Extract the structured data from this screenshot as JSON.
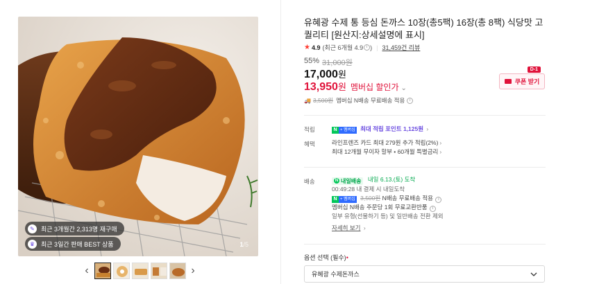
{
  "gallery": {
    "badges": [
      {
        "icon": "review-icon",
        "icon_glyph": "✎",
        "text": "최근 3개월간 2,313명 재구매"
      },
      {
        "icon": "best-icon",
        "icon_glyph": "♛",
        "text": "최근 3일간 판매 BEST 상품"
      }
    ],
    "counter": {
      "current": "1",
      "total": "/5"
    },
    "prev_arrow": "‹",
    "next_arrow": "›",
    "thumb_count": 5,
    "active_thumb": 1
  },
  "product": {
    "title": "유혜광 수제 통 등심 돈까스 10장(총5팩) 16장(총 8팩) 식당맛 고퀄리티 [원산지:상세설명에 표시]",
    "rating": {
      "star": "★",
      "score": "4.9",
      "recent": "(최근 6개월 4.9",
      "info_glyph": "i",
      "recent_close": ")",
      "reviews": "31,459건 리뷰"
    },
    "discount_rate": "55%",
    "original_price": "31,000원",
    "price": "17,000",
    "price_unit": "원",
    "member_price": "13,950",
    "member_unit": "원",
    "member_label": "멤버십 할인가",
    "member_chevron": "⌄",
    "coupon": {
      "badge": "D-1",
      "label": "쿠폰 받기"
    },
    "shipping_line": {
      "prefix": "🚚",
      "original": "3,500원",
      "text": "멤버십 N배송 무료배송 적용",
      "info_glyph": "i"
    }
  },
  "benefits": {
    "points_label": "적립",
    "npay_n": "N",
    "npay_text": "+ 멤버십",
    "points_text": "최대 적립 포인트",
    "points_value": "1,125원",
    "perks_label": "혜택",
    "perks_lines": [
      "라인프렌즈 카드 최대 279원 추가 적립(2%)",
      "최대 12개월 무이자 할부 • 60개월 특별금리"
    ],
    "chevron": "›"
  },
  "delivery": {
    "label": "배송",
    "fast_tag": "내일배송",
    "fast_dot": "N",
    "arrival": "내일 6.13.(토) 도착",
    "cutoff": "00:49:28  내 결제 시 내일도착",
    "free_ship_original": "3,500원",
    "free_ship_text": "N배송 무료배송 적용",
    "exchange_text": "멤버십 N배송 주문당 1회 무료교환반품",
    "exclude_text": "일부 유형(선물하기 등) 및 일반배송 전환 제외",
    "detail_link": "자세히 보기",
    "info_glyph": "i"
  },
  "option": {
    "label": "옵션 선택 (필수)",
    "required_mark": "•",
    "selected": "유혜광 수제돈까스"
  },
  "colors": {
    "accent_red": "#e0123a",
    "npay_green": "#03c75a",
    "point_purple": "#6b4ce0"
  }
}
